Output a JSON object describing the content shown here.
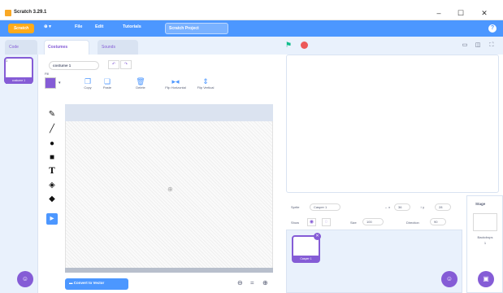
{
  "window": {
    "title": "Scratch 3.29.1",
    "minimize": "–",
    "maximize": "☐",
    "close": "✕"
  },
  "menu": {
    "logo": "Scratch",
    "globe": "⊕ ▾",
    "file": "File",
    "edit": "Edit",
    "tutorials": "Tutorials",
    "project_title": "Scratch Project",
    "help": "?"
  },
  "tabs": {
    "code": "Code",
    "costumes": "Costumes",
    "sounds": "Sounds"
  },
  "costume_list": {
    "index": "1",
    "thumb_label": "costume 1",
    "add_icon": "☺"
  },
  "paint": {
    "costume_name": "costume 1",
    "undo": "↶",
    "redo": "↷",
    "fill_label": "Fill",
    "caret": "▾",
    "copy": "Copy",
    "paste": "Paste",
    "delete": "Delete",
    "flip_h": "Flip Horizontal",
    "flip_v": "Flip Vertical",
    "convert": "Convert to Vector",
    "zoom_out": "⊖",
    "zoom_reset": "=",
    "zoom_in": "⊕"
  },
  "colors": {
    "accent": "#855cd6",
    "menu": "#4c97ff",
    "flag": "#0fbd8c",
    "stop": "#ec5959"
  },
  "sprite": {
    "sprite_label": "Sprite",
    "sprite_name": "Casper 1",
    "x_label": "↔ x",
    "x_value": "36",
    "y_label": "↕ y",
    "y_value": "28",
    "show_label": "Show",
    "size_label": "Size",
    "size_value": "100",
    "direction_label": "Direction",
    "direction_value": "90",
    "tile_label": "Casper 1",
    "delete_icon": "✕",
    "add_icon": "☺"
  },
  "stage_panel": {
    "title": "Stage",
    "backdrops_label": "Backdrops",
    "backdrops_count": "1",
    "add_icon": "▣"
  }
}
